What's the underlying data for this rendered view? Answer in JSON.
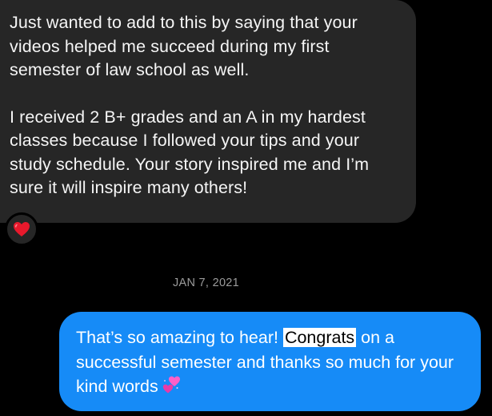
{
  "incoming": {
    "paragraph1": "Just wanted to add to this by saying that your videos helped me succeed during my first semester of law school as well.",
    "paragraph2": "I received 2 B+ grades and an A in my hardest classes because I followed your tips and your study schedule. Your story inspired me and I’m sure it will inspire many others!",
    "reaction_icon": "red-heart-emoji"
  },
  "timestamp": "JAN 7, 2021",
  "outgoing": {
    "text_before": "That’s so amazing to hear! ",
    "highlighted_word": "Congrats",
    "text_after": " on a successful semester and thanks so much for your kind words",
    "emoji_icon": "two-hearts-emoji"
  },
  "colors": {
    "background": "#000000",
    "incoming_bubble": "#262626",
    "outgoing_bubble": "#168bf7",
    "timestamp": "#9b9b9b",
    "reaction_heart": "#e8192c"
  }
}
